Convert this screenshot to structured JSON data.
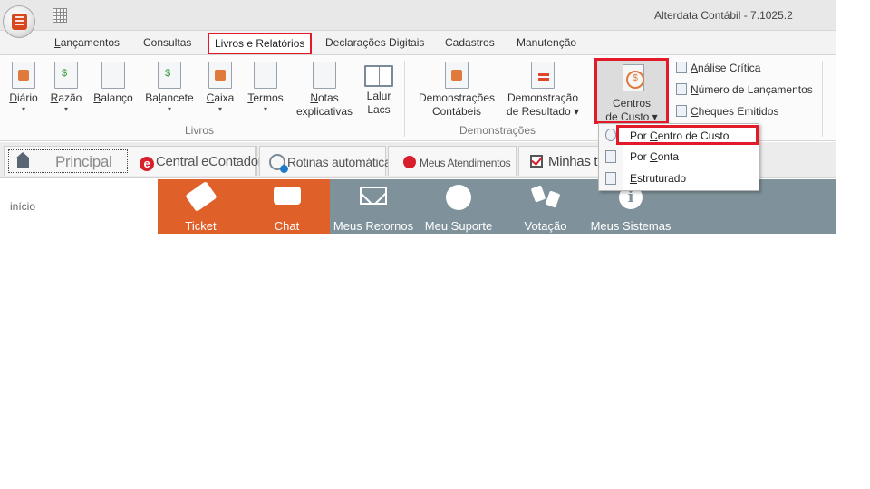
{
  "window": {
    "title": "Alterdata Contábil - 7.1025.2",
    "app_icon": "app-orb-icon",
    "quick_access_icon": "calculator-grid-icon"
  },
  "menu_tabs": [
    {
      "label": "Lançamentos",
      "underline": "L",
      "rest": "ançamentos"
    },
    {
      "label": "Consultas"
    },
    {
      "label": "Livros e Relatórios",
      "active": true
    },
    {
      "label": "Declarações Digitais"
    },
    {
      "label": "Cadastros"
    },
    {
      "label": "Manutenção"
    }
  ],
  "ribbon": {
    "groups": [
      {
        "label": "Livros"
      },
      {
        "label": "Demonstrações"
      }
    ],
    "livros": [
      {
        "pre": "",
        "u": "D",
        "post": "iário",
        "dropdown": true
      },
      {
        "pre": "",
        "u": "R",
        "post": "azão",
        "dropdown": true
      },
      {
        "pre": "",
        "u": "B",
        "post": "alanço",
        "dropdown": false
      },
      {
        "pre": "Ba",
        "u": "l",
        "post": "ancete",
        "dropdown": true
      },
      {
        "pre": "",
        "u": "C",
        "post": "aixa",
        "dropdown": true
      },
      {
        "pre": "",
        "u": "T",
        "post": "ermos",
        "dropdown": true
      },
      {
        "line1_u": "N",
        "line1_post": "otas",
        "line2": "explicativas",
        "dropdown": false
      },
      {
        "line1": "Lalur",
        "line2": "Lacs",
        "dropdown": false
      }
    ],
    "demonstracoes": [
      {
        "line1": "Demonstrações",
        "line2": "Contábeis"
      },
      {
        "line1": "Demonstração",
        "line2": "de Resultado",
        "dropdown": true
      }
    ],
    "centros": {
      "line1": "Centros",
      "line2": "de Custo",
      "dropdown": true
    },
    "small_items": [
      {
        "u": "A",
        "post": "nálise Crítica",
        "icon": "key-icon"
      },
      {
        "u": "N",
        "post": "úmero de Lançamentos",
        "icon": "document-stack-icon"
      },
      {
        "u": "C",
        "post": "heques Emitidos",
        "icon": "checkbook-icon"
      }
    ]
  },
  "dropdown_menu": [
    {
      "pre": "Por ",
      "u": "C",
      "post": "entro de Custo",
      "selected": true
    },
    {
      "pre": "Por ",
      "u": "C",
      "post": "onta"
    },
    {
      "pre": "",
      "u": "E",
      "post": "struturado"
    }
  ],
  "home_tabs": [
    {
      "label": "Principal",
      "icon": "home-icon"
    },
    {
      "label": "Central eContador",
      "icon": "econtador-icon"
    },
    {
      "label": "Rotinas automáticas",
      "icon": "gear-clock-icon"
    },
    {
      "label": "Meus Atendimentos",
      "icon": "alterdata-icon"
    },
    {
      "label": "Minhas t",
      "icon": "checkbox-icon"
    }
  ],
  "dashboard": {
    "breadcrumb": "início",
    "tiles": [
      {
        "label": "Ticket",
        "icon": "ticket-icon"
      },
      {
        "label": "Chat",
        "icon": "chat-icon"
      },
      {
        "label": "Meus Retornos",
        "icon": "mail-icon"
      },
      {
        "label": "Meu Suporte",
        "icon": "user-icon"
      },
      {
        "label": "Votação",
        "icon": "thumbs-icon"
      },
      {
        "label": "Meus Sistemas",
        "icon": "info-icon"
      }
    ],
    "colors": {
      "orange": "#e0602a",
      "gray": "#7f929b",
      "highlight": "#e21b2b"
    }
  }
}
